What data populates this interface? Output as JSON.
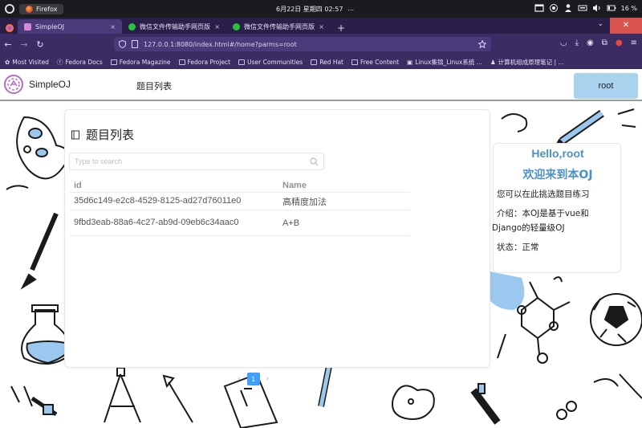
{
  "os": {
    "app_name": "Firefox",
    "datetime": "6月22日 星期四  02:57",
    "dots": "...",
    "battery": "16 %"
  },
  "browser": {
    "tabs": [
      {
        "label": "SimpleOJ",
        "active": true
      },
      {
        "label": "微信文件传输助手网页版",
        "active": false
      },
      {
        "label": "微信文件传输助手网页版",
        "active": false
      }
    ],
    "new_tab": "+",
    "close_tab": "×",
    "url": "127.0.0.1:8080/index.html#/home?parms=root",
    "bookmarks": [
      "Most Visited",
      "Fedora Docs",
      "Fedora Magazine",
      "Fedora Project",
      "User Communities",
      "Red Hat",
      "Free Content",
      "Linux集锦_Linux系统 ...",
      "计算机组成原理笔记 | ..."
    ]
  },
  "app": {
    "brand": "SimpleOJ",
    "menu_problems": "题目列表",
    "user_button": "root"
  },
  "problems": {
    "title": "题目列表",
    "search_placeholder": "Type to search",
    "columns": {
      "id": "id",
      "name": "Name"
    },
    "rows": [
      {
        "id": "35d6c149-e2c8-4529-8125-ad27d76011e0",
        "name": "高精度加法"
      },
      {
        "id": "9fbd3eab-88a6-4c27-ab9d-09eb6c34aac0",
        "name": "A+B"
      }
    ],
    "pagination": {
      "prev": "‹",
      "current": "1",
      "next": "›"
    }
  },
  "side": {
    "hello": "Hello,root",
    "welcome": "欢迎来到本OJ",
    "line1": "您可以在此挑选题目练习",
    "line2": "介绍：本OJ是基于vue和",
    "line3": "Django的轻量级OJ",
    "line4": "状态：正常"
  },
  "colors": {
    "accent": "#409eff",
    "user_button": "#a8d2ee",
    "hello": "#4a91c6",
    "browser": "#3b2d63"
  }
}
